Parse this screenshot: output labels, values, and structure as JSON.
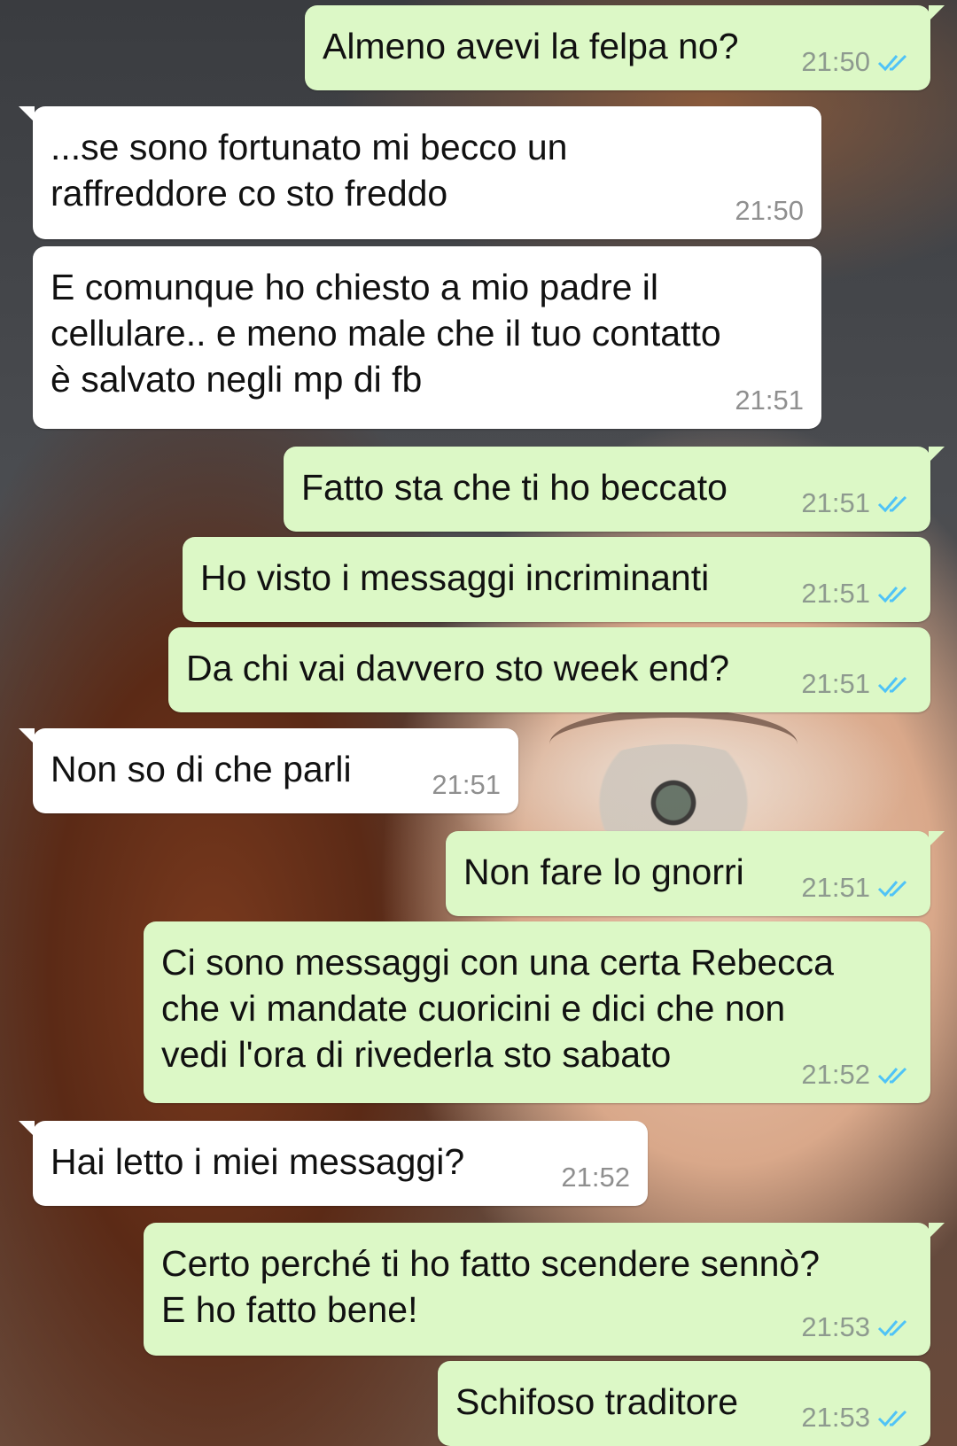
{
  "messages": [
    {
      "text": "Almeno avevi la felpa no?",
      "time": "21:50"
    },
    {
      "text": "...se sono fortunato mi becco un\nraffreddore co sto freddo",
      "time": "21:50"
    },
    {
      "text": "E comunque ho chiesto a mio padre il\ncellulare.. e meno male che il tuo contatto\nè salvato negli mp di fb",
      "time": "21:51"
    },
    {
      "text": "Fatto sta che ti ho beccato",
      "time": "21:51"
    },
    {
      "text": "Ho visto i messaggi incriminanti",
      "time": "21:51"
    },
    {
      "text": "Da chi vai davvero sto week end?",
      "time": "21:51"
    },
    {
      "text": "Non so di che parli",
      "time": "21:51"
    },
    {
      "text": "Non fare lo gnorri",
      "time": "21:51"
    },
    {
      "text": "Ci sono messaggi con una certa Rebecca\nche vi mandate cuoricini e dici che non\nvedi l'ora di rivederla sto sabato",
      "time": "21:52"
    },
    {
      "text": "Hai letto i miei messaggi?",
      "time": "21:52"
    },
    {
      "text": "Certo perché ti ho fatto scendere sennò?\nE ho fatto bene!",
      "time": "21:53"
    },
    {
      "text": "Schifoso traditore",
      "time": "21:53"
    }
  ],
  "colors": {
    "outgoing_bubble": "#dcf8c6",
    "incoming_bubble": "#ffffff",
    "read_ticks": "#4fc3f7"
  },
  "icons": {
    "read_status": "double-check-icon"
  }
}
